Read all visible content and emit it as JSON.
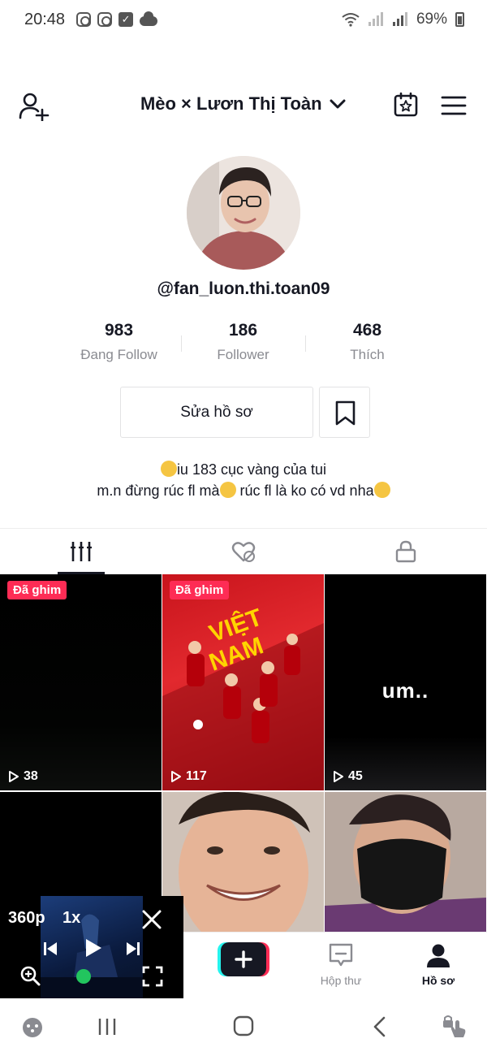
{
  "status_bar": {
    "time": "20:48",
    "battery": "69%"
  },
  "header": {
    "title": "Mèo × Lươn Thị Toàn"
  },
  "profile": {
    "username": "@fan_luon.thi.toan09",
    "stats": [
      {
        "value": "983",
        "label": "Đang Follow"
      },
      {
        "value": "186",
        "label": "Follower"
      },
      {
        "value": "468",
        "label": "Thích"
      }
    ],
    "edit_button_label": "Sửa hồ sơ",
    "bio_line1": "iu 183 cục vàng của tui",
    "bio_line2_a": "m.n đừng rúc fl mà",
    "bio_line2_b": " rúc fl là ko có vd nha"
  },
  "videos": [
    {
      "pinned_label": "Đã ghim",
      "views": "38"
    },
    {
      "pinned_label": "Đã ghim",
      "views": "117"
    },
    {
      "views": "45",
      "overlay_text": "um.."
    },
    {},
    {},
    {}
  ],
  "mini_player": {
    "resolution": "360p",
    "speed": "1x"
  },
  "bottom_nav": {
    "inbox_label": "Hộp thư",
    "profile_label": "Hồ sơ"
  },
  "colors": {
    "accent": "#fe2c55",
    "text": "#161823",
    "muted": "#8a8b91"
  }
}
